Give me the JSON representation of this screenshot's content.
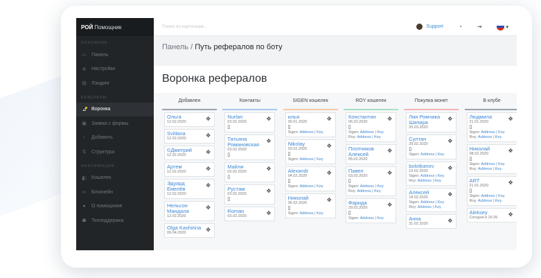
{
  "brand": {
    "bold": "РОЙ",
    "rest": "Помощник"
  },
  "search": {
    "placeholder": "Поиск по карточкам..."
  },
  "topbar": {
    "support": "Support",
    "clock_icon": "clock-icon",
    "logout_icon": "logout-icon",
    "caret": "▾"
  },
  "sidebar": {
    "sections": [
      {
        "title": "ОСНОВНОЕ",
        "items": [
          {
            "label": "Панель",
            "icon": "monitor-icon",
            "glyph": "▭"
          },
          {
            "label": "Настройки",
            "icon": "gear-icon",
            "glyph": "✲"
          },
          {
            "label": "Лэндинг",
            "icon": "card-icon",
            "glyph": "▤"
          }
        ]
      },
      {
        "title": "РЕФЕРАЛЫ",
        "items": [
          {
            "label": "Воронка",
            "icon": "funnel-icon",
            "glyph": "⊿",
            "active": true
          },
          {
            "label": "Заявки с формы",
            "icon": "form-icon",
            "glyph": "▣"
          },
          {
            "label": "Добавить",
            "icon": "user-plus-icon",
            "glyph": "⁺"
          },
          {
            "label": "Структура",
            "icon": "structure-icon",
            "glyph": "⇅"
          }
        ]
      },
      {
        "title": "ИНФОРМАЦИЯ",
        "items": [
          {
            "label": "Кошелек",
            "icon": "wallet-icon",
            "glyph": "◧"
          },
          {
            "label": "Блокчейн",
            "icon": "chain-icon",
            "glyph": "∞"
          },
          {
            "label": "О помощнике",
            "icon": "info-icon",
            "glyph": "●"
          },
          {
            "label": "Техподдержка",
            "icon": "support-icon",
            "glyph": "☗"
          }
        ]
      }
    ]
  },
  "breadcrumb": {
    "root": "Панель",
    "sep": "/",
    "current": "Путь рефералов по боту"
  },
  "panel": {
    "title": "Воронка рефералов"
  },
  "link_labels": {
    "sigen": "Sigen:",
    "roy": "Roy:",
    "address": "Address",
    "key": "Key",
    "sep": "|"
  },
  "columns": [
    {
      "title": "Добавлен",
      "color": "#9aa3ad",
      "cards": [
        {
          "name": "Ольга",
          "date": "12.02.2020"
        },
        {
          "name": "Svitlana",
          "date": "12.02.2020"
        },
        {
          "name": "©Дмитрий",
          "date": "12.02.2020"
        },
        {
          "name": "Артем",
          "date": "12.02.2020"
        },
        {
          "name": "Эдуард Емелёв",
          "date": "12.02.2020"
        },
        {
          "name": "Нельсон Мандала",
          "date": "12.02.2020"
        },
        {
          "name": "Olga Kashirina",
          "date": "09.04.2020"
        }
      ]
    },
    {
      "title": "Контакты",
      "color": "#a9c8ec",
      "cards": [
        {
          "name": "Nurlan",
          "date": "03.02.2020",
          "phone": true
        },
        {
          "name": "Татьяна Романовская",
          "date": "03.02.2020",
          "phone": true
        },
        {
          "name": "Майли",
          "date": "03.02.2020",
          "phone": true
        },
        {
          "name": "Рустам",
          "date": "03.02.2020",
          "phone": true
        },
        {
          "name": "Roman",
          "date": "03.02.2020"
        }
      ]
    },
    {
      "title": "SIGEN кошелек",
      "color": "#f5c7a6",
      "cards": [
        {
          "name": "илья",
          "date": "30.01.2020",
          "phone": true,
          "sigen": true
        },
        {
          "name": "Nikolay",
          "date": "03.02.2020",
          "phone": true,
          "sigen": true
        },
        {
          "name": "Alexandr",
          "date": "04.02.2020",
          "phone": true,
          "sigen": true
        },
        {
          "name": "Николай",
          "date": "06.02.2020",
          "phone": true,
          "sigen": true
        }
      ]
    },
    {
      "title": "ROY кошелек",
      "color": "#a8dfc4",
      "cards": [
        {
          "name": "Константин",
          "date": "06.02.2020",
          "phone": true,
          "sigen": true,
          "roy": true
        },
        {
          "name": "Плотников Алексей",
          "date": "05.02.2020"
        },
        {
          "name": "Павел",
          "date": "03.02.2020",
          "phone": true,
          "sigen": true,
          "roy": true
        },
        {
          "name": "Фарида",
          "date": "29.02.2020",
          "phone": true,
          "sigen": true
        }
      ]
    },
    {
      "title": "Покупка монет",
      "color": "#f3b4b4",
      "cards": [
        {
          "name": "Лия Ромчика Шапира",
          "date": "25.03.2020"
        },
        {
          "name": "Султан",
          "date": "29.02.2020",
          "phone": true,
          "sigen": true
        },
        {
          "name": "bolotkanov",
          "date": "13.02.2020",
          "sigen": true,
          "roy": true
        },
        {
          "name": "Алексей",
          "date": "18.02.2020",
          "sigen": true,
          "roy": true
        },
        {
          "name": "Анна",
          "date": "31.02.2020"
        }
      ]
    },
    {
      "title": "В клубе",
      "color": "#9aa3ad",
      "cards": [
        {
          "name": "Людмила",
          "date": "21.01.2020",
          "phone": true,
          "sigen": true,
          "roy": true
        },
        {
          "name": "Николай",
          "date": "08.02.2020",
          "phone": true,
          "sigen": true,
          "roy": true
        },
        {
          "name": "ART",
          "date": "21.01.2020",
          "phone": true,
          "sigen": true,
          "roy": true
        },
        {
          "name": "Aleksey",
          "date": "Сегодня в 16:25"
        }
      ]
    }
  ]
}
